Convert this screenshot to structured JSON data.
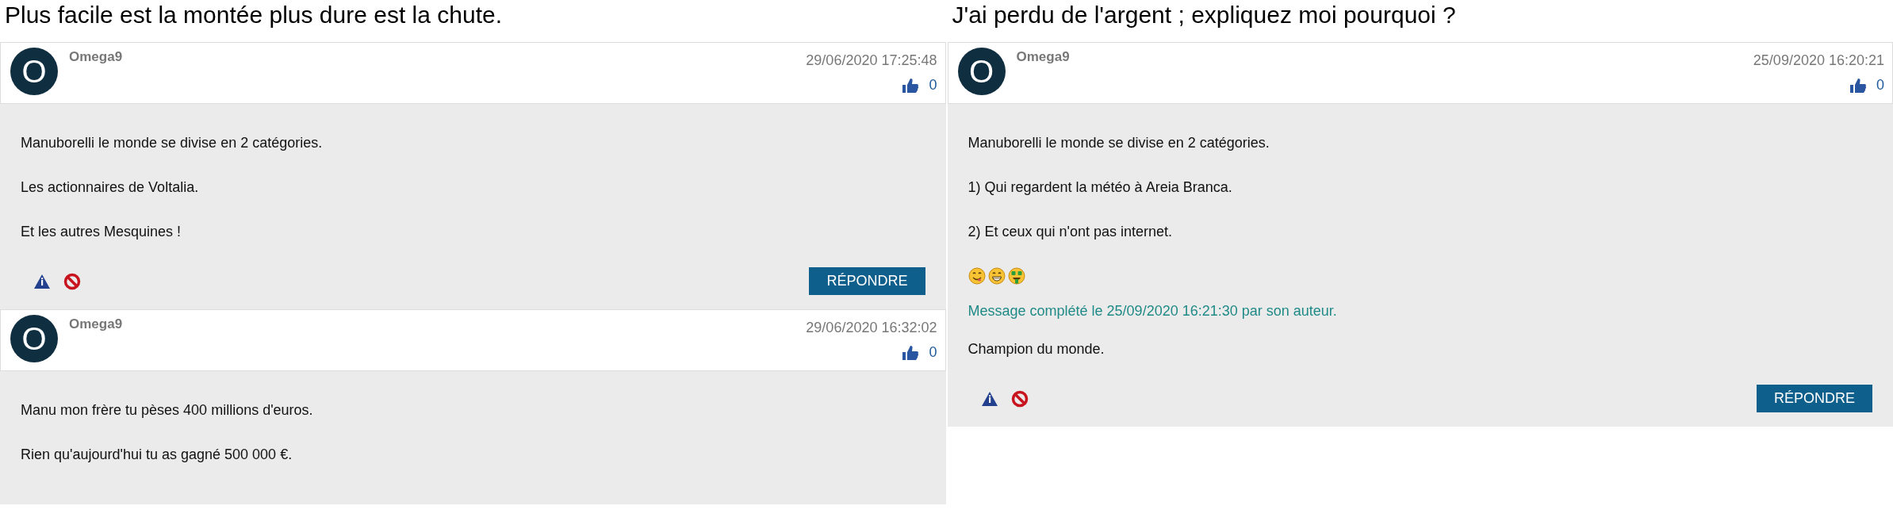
{
  "columns": [
    {
      "title": "Plus facile est la montée plus dure est la chute.",
      "posts": [
        {
          "avatar": "O",
          "author": "Omega9",
          "date": "29/06/2020 17:25:48",
          "likes": "0",
          "body": [
            {
              "kind": "text",
              "text": "Manuborelli le monde se divise en 2 catégories."
            },
            {
              "kind": "text",
              "text": "Les actionnaires de Voltalia."
            },
            {
              "kind": "text",
              "text": "Et les autres Mesquines !"
            }
          ],
          "reply": "RÉPONDRE"
        },
        {
          "avatar": "O",
          "author": "Omega9",
          "date": "29/06/2020 16:32:02",
          "likes": "0",
          "body": [
            {
              "kind": "text",
              "text": "Manu mon frère tu pèses 400 millions d'euros."
            },
            {
              "kind": "text",
              "text": "Rien qu'aujourd'hui tu as gagné 500 000 €."
            }
          ]
        }
      ]
    },
    {
      "title": "J'ai perdu de l'argent ; expliquez moi pourquoi ?",
      "posts": [
        {
          "avatar": "O",
          "author": "Omega9",
          "date": "25/09/2020 16:20:21",
          "likes": "0",
          "body": [
            {
              "kind": "text",
              "text": "Manuborelli le monde se divise en 2 catégories."
            },
            {
              "kind": "text",
              "text": "1) Qui regardent la météo à Areia Branca."
            },
            {
              "kind": "text",
              "text": "2) Et ceux qui n'ont pas internet."
            },
            {
              "kind": "emojis",
              "emojis": [
                {
                  "kind": "yum"
                },
                {
                  "kind": "grin"
                },
                {
                  "kind": "money"
                }
              ]
            },
            {
              "kind": "edit_note",
              "text": "Message complété le 25/09/2020 16:21:30 par son auteur."
            },
            {
              "kind": "text",
              "text": "Champion du monde."
            }
          ],
          "reply": "RÉPONDRE"
        }
      ]
    }
  ]
}
